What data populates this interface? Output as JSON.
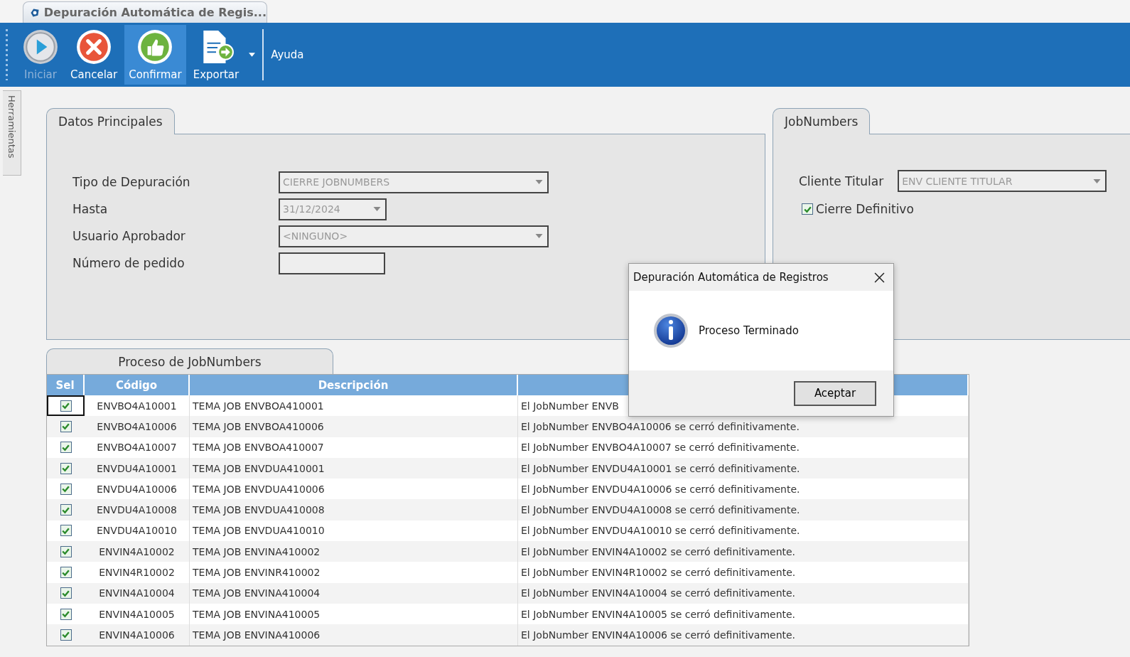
{
  "window": {
    "tab_title": "Depuración Automática de Regis..."
  },
  "toolbar": {
    "buttons": [
      {
        "kind": "play",
        "label": "Iniciar",
        "disabled": true,
        "selected": false,
        "dropdown": false
      },
      {
        "kind": "cancel",
        "label": "Cancelar",
        "disabled": false,
        "selected": false,
        "dropdown": false
      },
      {
        "kind": "confirm",
        "label": "Confirmar",
        "disabled": false,
        "selected": true,
        "dropdown": false
      },
      {
        "kind": "export",
        "label": "Exportar",
        "disabled": false,
        "selected": false,
        "dropdown": true
      }
    ],
    "help": "Ayuda"
  },
  "side_tab": "Herramientas",
  "main_panel": {
    "tab": "Datos Principales",
    "fields": [
      {
        "kind": "combo",
        "label": "Tipo de Depuración",
        "value": "CIERRE JOBNUMBERS"
      },
      {
        "kind": "date",
        "label": "Hasta",
        "value": "31/12/2024"
      },
      {
        "kind": "combo",
        "label": "Usuario Aprobador",
        "value": "<NINGUNO>"
      },
      {
        "kind": "text",
        "label": "Número de pedido"
      }
    ]
  },
  "jobnumbers_panel": {
    "tab": "JobNumbers",
    "client_label": "Cliente Titular",
    "client_value": "ENV CLIENTE TITULAR",
    "final_close": {
      "label": "Cierre Definitivo",
      "checked": true
    }
  },
  "process_panel": {
    "tab": "Proceso de JobNumbers",
    "table": {
      "columns": [
        "Sel",
        "Código",
        "Descripción"
      ],
      "rows": [
        {
          "checked": true,
          "focused": true,
          "code": "ENVBO4A10001",
          "description": "TEMA JOB ENVBOA410001",
          "column_4": "El JobNumber ENVB"
        },
        {
          "checked": true,
          "focused": false,
          "code": "ENVBO4A10006",
          "description": "TEMA JOB ENVBOA410006",
          "column_4": "El JobNumber ENVBO4A10006 se cerró definitivamente."
        },
        {
          "checked": true,
          "focused": false,
          "code": "ENVBO4A10007",
          "description": "TEMA JOB ENVBOA410007",
          "column_4": "El JobNumber ENVBO4A10007 se cerró definitivamente."
        },
        {
          "checked": true,
          "focused": false,
          "code": "ENVDU4A10001",
          "description": "TEMA JOB ENVDUA410001",
          "column_4": "El JobNumber ENVDU4A10001 se cerró definitivamente."
        },
        {
          "checked": true,
          "focused": false,
          "code": "ENVDU4A10006",
          "description": "TEMA JOB ENVDUA410006",
          "column_4": "El JobNumber ENVDU4A10006 se cerró definitivamente."
        },
        {
          "checked": true,
          "focused": false,
          "code": "ENVDU4A10008",
          "description": "TEMA JOB ENVDUA410008",
          "column_4": "El JobNumber ENVDU4A10008 se cerró definitivamente."
        },
        {
          "checked": true,
          "focused": false,
          "code": "ENVDU4A10010",
          "description": "TEMA JOB ENVDUA410010",
          "column_4": "El JobNumber ENVDU4A10010 se cerró definitivamente."
        },
        {
          "checked": true,
          "focused": false,
          "code": "ENVIN4A10002",
          "description": "TEMA JOB ENVINA410002",
          "column_4": "El JobNumber ENVIN4A10002 se cerró definitivamente."
        },
        {
          "checked": true,
          "focused": false,
          "code": "ENVIN4R10002",
          "description": "TEMA JOB ENVINR410002",
          "column_4": "El JobNumber ENVIN4R10002 se cerró definitivamente."
        },
        {
          "checked": true,
          "focused": false,
          "code": "ENVIN4A10004",
          "description": "TEMA JOB ENVINA410004",
          "column_4": "El JobNumber ENVIN4A10004 se cerró definitivamente."
        },
        {
          "checked": true,
          "focused": false,
          "code": "ENVIN4A10005",
          "description": "TEMA JOB ENVINA410005",
          "column_4": "El JobNumber ENVIN4A10005 se cerró definitivamente."
        },
        {
          "checked": true,
          "focused": false,
          "code": "ENVIN4A10006",
          "description": "TEMA JOB ENVINA410006",
          "column_4": "El JobNumber ENVIN4A10006 se cerró definitivamente."
        }
      ]
    }
  },
  "dialog": {
    "title": "Depuración Automática de Registros",
    "message": "Proceso Terminado",
    "button": "Aceptar"
  }
}
